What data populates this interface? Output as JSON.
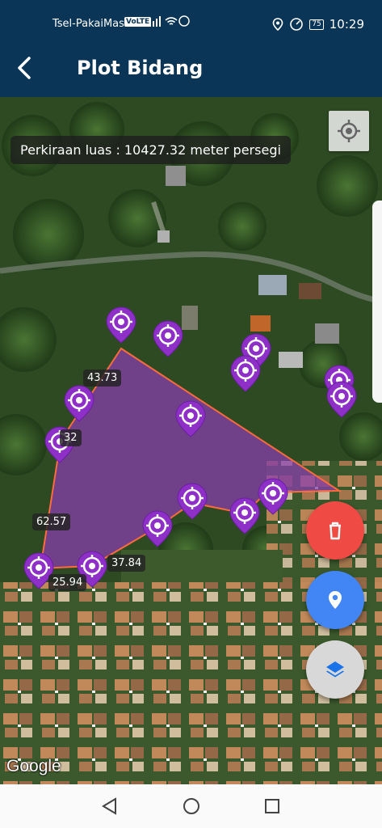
{
  "status_bar": {
    "carrier": "Tsel-PakaiMas...",
    "volte": "VoLTE",
    "battery": "75",
    "time": "10:29"
  },
  "app_bar": {
    "title": "Plot Bidang",
    "back_icon": "arrow-left-icon"
  },
  "map": {
    "area_label": "Perkiraan luas : 10427.32 meter persegi",
    "polygon_fill": "#8a3fb0",
    "polygon_stroke": "#ff6b3d",
    "marker_color": "#8e2fc7",
    "distance_labels": [
      "43.73",
      "32",
      "62.57",
      "25.94",
      "37.84"
    ],
    "marker_count": 15,
    "google_logo": "Google"
  },
  "buttons": {
    "locate_icon": "my-location-icon",
    "delete_icon": "trash-icon",
    "delete_color": "#ef4a43",
    "location_icon": "place-pin-icon",
    "location_color": "#4285f4",
    "layers_icon": "layers-icon"
  },
  "nav_bar": {
    "back_icon": "triangle-back-icon",
    "home_icon": "circle-home-icon",
    "recents_icon": "square-recents-icon"
  }
}
